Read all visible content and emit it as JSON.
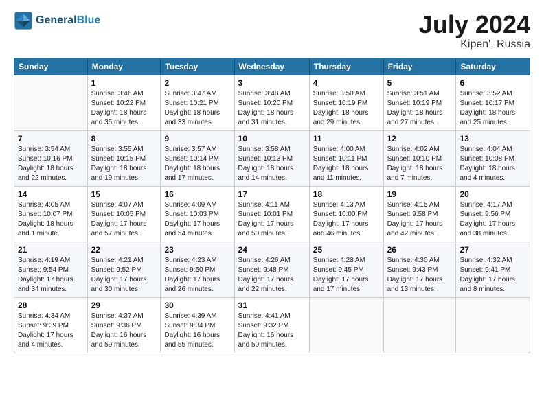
{
  "header": {
    "logo_line1": "General",
    "logo_line2": "Blue",
    "title": "July 2024",
    "subtitle": "Kipen', Russia"
  },
  "days_of_week": [
    "Sunday",
    "Monday",
    "Tuesday",
    "Wednesday",
    "Thursday",
    "Friday",
    "Saturday"
  ],
  "weeks": [
    [
      {
        "day": "",
        "info": ""
      },
      {
        "day": "1",
        "info": "Sunrise: 3:46 AM\nSunset: 10:22 PM\nDaylight: 18 hours\nand 35 minutes."
      },
      {
        "day": "2",
        "info": "Sunrise: 3:47 AM\nSunset: 10:21 PM\nDaylight: 18 hours\nand 33 minutes."
      },
      {
        "day": "3",
        "info": "Sunrise: 3:48 AM\nSunset: 10:20 PM\nDaylight: 18 hours\nand 31 minutes."
      },
      {
        "day": "4",
        "info": "Sunrise: 3:50 AM\nSunset: 10:19 PM\nDaylight: 18 hours\nand 29 minutes."
      },
      {
        "day": "5",
        "info": "Sunrise: 3:51 AM\nSunset: 10:19 PM\nDaylight: 18 hours\nand 27 minutes."
      },
      {
        "day": "6",
        "info": "Sunrise: 3:52 AM\nSunset: 10:17 PM\nDaylight: 18 hours\nand 25 minutes."
      }
    ],
    [
      {
        "day": "7",
        "info": "Sunrise: 3:54 AM\nSunset: 10:16 PM\nDaylight: 18 hours\nand 22 minutes."
      },
      {
        "day": "8",
        "info": "Sunrise: 3:55 AM\nSunset: 10:15 PM\nDaylight: 18 hours\nand 19 minutes."
      },
      {
        "day": "9",
        "info": "Sunrise: 3:57 AM\nSunset: 10:14 PM\nDaylight: 18 hours\nand 17 minutes."
      },
      {
        "day": "10",
        "info": "Sunrise: 3:58 AM\nSunset: 10:13 PM\nDaylight: 18 hours\nand 14 minutes."
      },
      {
        "day": "11",
        "info": "Sunrise: 4:00 AM\nSunset: 10:11 PM\nDaylight: 18 hours\nand 11 minutes."
      },
      {
        "day": "12",
        "info": "Sunrise: 4:02 AM\nSunset: 10:10 PM\nDaylight: 18 hours\nand 7 minutes."
      },
      {
        "day": "13",
        "info": "Sunrise: 4:04 AM\nSunset: 10:08 PM\nDaylight: 18 hours\nand 4 minutes."
      }
    ],
    [
      {
        "day": "14",
        "info": "Sunrise: 4:05 AM\nSunset: 10:07 PM\nDaylight: 18 hours\nand 1 minute."
      },
      {
        "day": "15",
        "info": "Sunrise: 4:07 AM\nSunset: 10:05 PM\nDaylight: 17 hours\nand 57 minutes."
      },
      {
        "day": "16",
        "info": "Sunrise: 4:09 AM\nSunset: 10:03 PM\nDaylight: 17 hours\nand 54 minutes."
      },
      {
        "day": "17",
        "info": "Sunrise: 4:11 AM\nSunset: 10:01 PM\nDaylight: 17 hours\nand 50 minutes."
      },
      {
        "day": "18",
        "info": "Sunrise: 4:13 AM\nSunset: 10:00 PM\nDaylight: 17 hours\nand 46 minutes."
      },
      {
        "day": "19",
        "info": "Sunrise: 4:15 AM\nSunset: 9:58 PM\nDaylight: 17 hours\nand 42 minutes."
      },
      {
        "day": "20",
        "info": "Sunrise: 4:17 AM\nSunset: 9:56 PM\nDaylight: 17 hours\nand 38 minutes."
      }
    ],
    [
      {
        "day": "21",
        "info": "Sunrise: 4:19 AM\nSunset: 9:54 PM\nDaylight: 17 hours\nand 34 minutes."
      },
      {
        "day": "22",
        "info": "Sunrise: 4:21 AM\nSunset: 9:52 PM\nDaylight: 17 hours\nand 30 minutes."
      },
      {
        "day": "23",
        "info": "Sunrise: 4:23 AM\nSunset: 9:50 PM\nDaylight: 17 hours\nand 26 minutes."
      },
      {
        "day": "24",
        "info": "Sunrise: 4:26 AM\nSunset: 9:48 PM\nDaylight: 17 hours\nand 22 minutes."
      },
      {
        "day": "25",
        "info": "Sunrise: 4:28 AM\nSunset: 9:45 PM\nDaylight: 17 hours\nand 17 minutes."
      },
      {
        "day": "26",
        "info": "Sunrise: 4:30 AM\nSunset: 9:43 PM\nDaylight: 17 hours\nand 13 minutes."
      },
      {
        "day": "27",
        "info": "Sunrise: 4:32 AM\nSunset: 9:41 PM\nDaylight: 17 hours\nand 8 minutes."
      }
    ],
    [
      {
        "day": "28",
        "info": "Sunrise: 4:34 AM\nSunset: 9:39 PM\nDaylight: 17 hours\nand 4 minutes."
      },
      {
        "day": "29",
        "info": "Sunrise: 4:37 AM\nSunset: 9:36 PM\nDaylight: 16 hours\nand 59 minutes."
      },
      {
        "day": "30",
        "info": "Sunrise: 4:39 AM\nSunset: 9:34 PM\nDaylight: 16 hours\nand 55 minutes."
      },
      {
        "day": "31",
        "info": "Sunrise: 4:41 AM\nSunset: 9:32 PM\nDaylight: 16 hours\nand 50 minutes."
      },
      {
        "day": "",
        "info": ""
      },
      {
        "day": "",
        "info": ""
      },
      {
        "day": "",
        "info": ""
      }
    ]
  ]
}
